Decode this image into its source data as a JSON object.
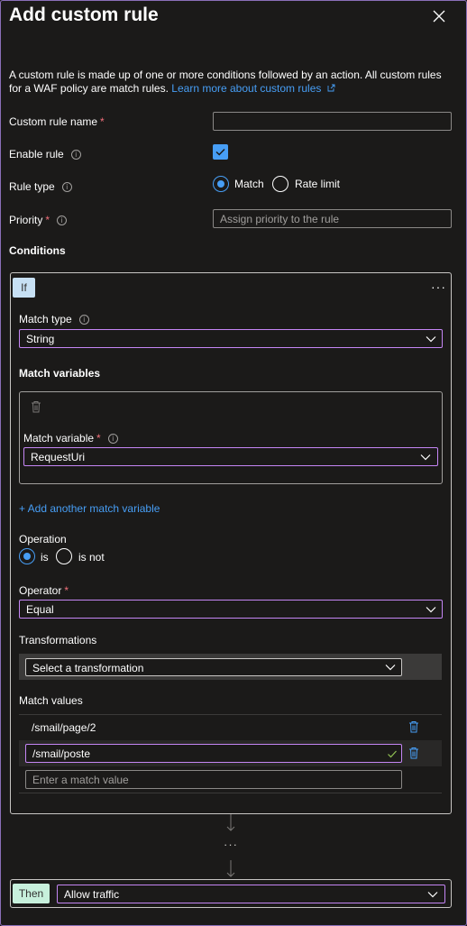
{
  "panel": {
    "title": "Add custom rule",
    "description": "A custom rule is made up of one or more conditions followed by an action. All custom rules for a WAF policy are match rules.",
    "learn_more": "Learn more about custom rules"
  },
  "form": {
    "custom_rule_name_label": "Custom rule name",
    "enable_rule_label": "Enable rule",
    "enable_rule_checked": true,
    "rule_type_label": "Rule type",
    "rule_type_options": [
      "Match",
      "Rate limit"
    ],
    "rule_type_selected": "Match",
    "priority_label": "Priority",
    "priority_placeholder": "Assign priority to the rule"
  },
  "conditions": {
    "heading": "Conditions",
    "if_label": "If",
    "more_label": "···",
    "match_type_label": "Match type",
    "match_type_value": "String",
    "match_variables_heading": "Match variables",
    "match_variable_label": "Match variable",
    "match_variable_value": "RequestUri",
    "add_match_variable": "+ Add another match variable",
    "operation_label": "Operation",
    "operation_options": [
      "is",
      "is not"
    ],
    "operation_selected": "is",
    "operator_label": "Operator",
    "operator_value": "Equal",
    "transformations_label": "Transformations",
    "transformation_placeholder": "Select a transformation",
    "match_values_label": "Match values",
    "match_values": [
      "/smail/page/2",
      "/smail/poste"
    ],
    "match_value_placeholder": "Enter a match value"
  },
  "flow": {
    "ellipsis": "···"
  },
  "then": {
    "then_label": "Then",
    "action_value": "Allow traffic"
  },
  "colors": {
    "accent": "#479ef5",
    "focus_border": "#c586f5",
    "background": "#1b1a19",
    "required": "#f1707b"
  }
}
